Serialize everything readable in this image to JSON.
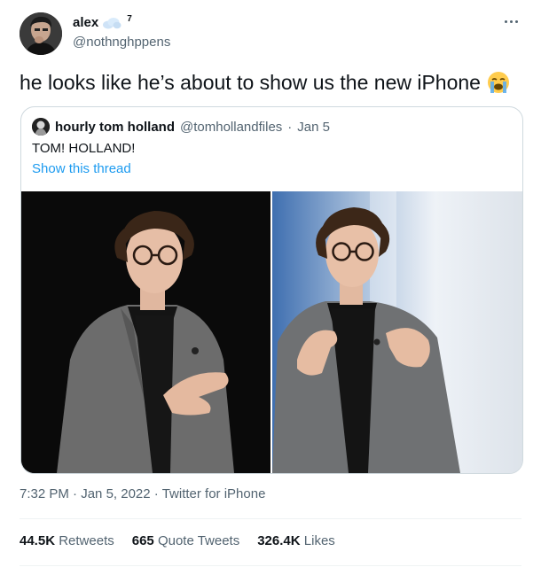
{
  "author": {
    "display_name": "alex",
    "name_superscript": "7",
    "handle": "@nothnghppens"
  },
  "tweet": {
    "text": "he looks like he’s about to show us the new iPhone",
    "emoji": "loudly-crying-face"
  },
  "quoted_tweet": {
    "display_name": "hourly tom holland",
    "handle": "@tomhollandfiles",
    "separator": "·",
    "date": "Jan 5",
    "text": "TOM! HOLLAND!",
    "thread_link": "Show this thread",
    "media": [
      {
        "description_icon": "photo"
      },
      {
        "description_icon": "photo"
      }
    ]
  },
  "meta": {
    "time": "7:32 PM",
    "sep1": "·",
    "date": "Jan 5, 2022",
    "sep2": "·",
    "source": "Twitter for iPhone"
  },
  "stats": {
    "retweets_count": "44.5K",
    "retweets_label": "Retweets",
    "quotes_count": "665",
    "quotes_label": "Quote Tweets",
    "likes_count": "326.4K",
    "likes_label": "Likes"
  },
  "colors": {
    "link": "#1d9bf0",
    "secondary_text": "#536471",
    "primary_text": "#0f1419",
    "border": "#cfd9de"
  }
}
